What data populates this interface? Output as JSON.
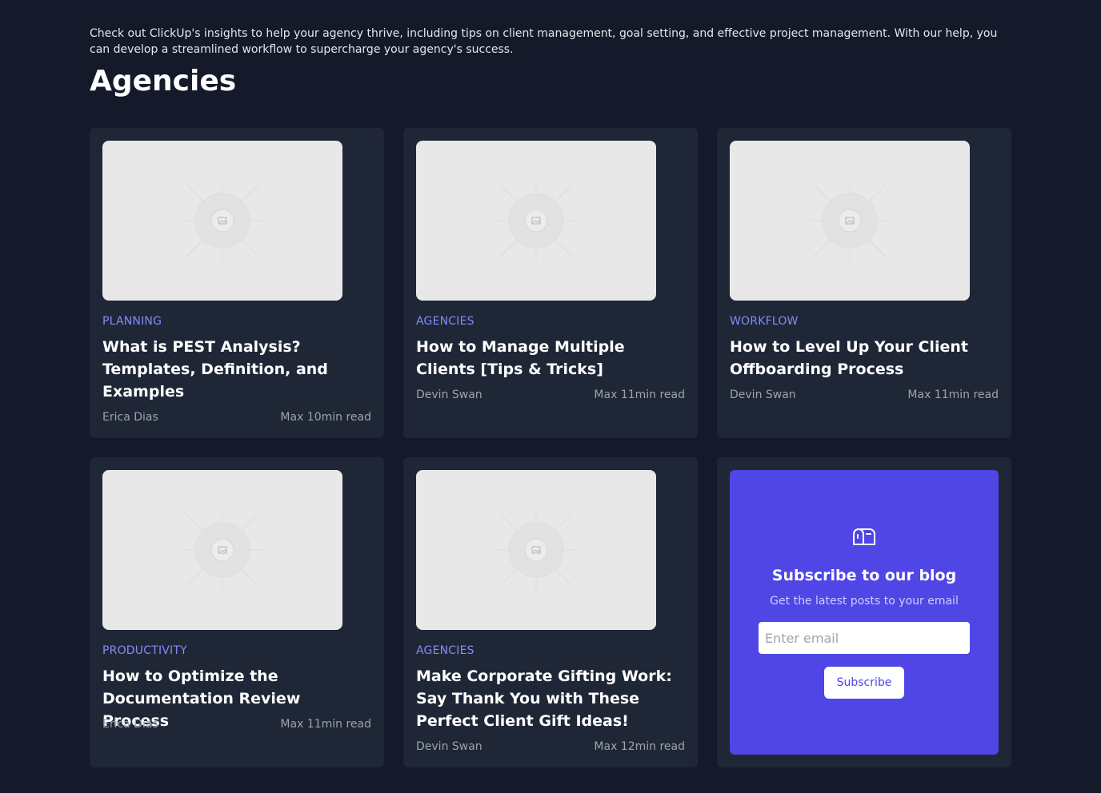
{
  "intro": "Check out ClickUp's insights to help your agency thrive, including tips on client management, goal setting, and effective project management. With our help, you can develop a streamlined workflow to supercharge your agency's success.",
  "heading": "Agencies",
  "posts": [
    {
      "category": "PLANNING",
      "title": "What is PEST Analysis? Templates, Definition, and Examples",
      "author": "Erica Dias",
      "read_time": "Max 10min read"
    },
    {
      "category": "AGENCIES",
      "title": "How to Manage Multiple Clients [Tips & Tricks]",
      "author": "Devin Swan",
      "read_time": "Max 11min read"
    },
    {
      "category": "WORKFLOW",
      "title": "How to Level Up Your Client Offboarding Process",
      "author": "Devin Swan",
      "read_time": "Max 11min read"
    },
    {
      "category": "PRODUCTIVITY",
      "title": "How to Optimize the Documentation Review Process",
      "author": "Erica Dias",
      "read_time": "Max 11min read"
    },
    {
      "category": "AGENCIES",
      "title": "Make Corporate Gifting Work: Say Thank You with These Perfect Client Gift Ideas!",
      "author": "Devin Swan",
      "read_time": "Max 12min read"
    }
  ],
  "subscribe": {
    "icon": "mailbox-icon",
    "title": "Subscribe to our blog",
    "description": "Get the latest posts to your email",
    "email_placeholder": "Enter email",
    "email_value": "",
    "button_label": "Subscribe"
  },
  "colors": {
    "page_bg": "#141a2a",
    "card_bg": "#1f2737",
    "category": "#818cf8",
    "accent": "#4f46e5"
  }
}
